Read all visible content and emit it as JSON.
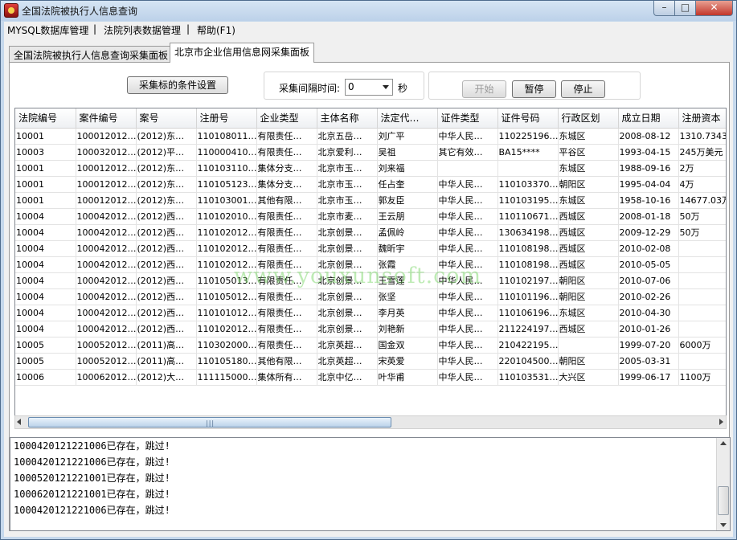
{
  "window": {
    "title": "全国法院被执行人信息查询"
  },
  "menu": {
    "items": [
      "MYSQL数据库管理",
      "|",
      "法院列表数据管理",
      "|",
      "帮助(F1)"
    ]
  },
  "tabs": [
    "全国法院被执行人信息查询采集面板",
    "北京市企业信用信息网采集面板"
  ],
  "toolbar": {
    "conditions_button": "采集标的条件设置",
    "interval_label": "采集间隔时间:",
    "interval_value": "0",
    "interval_unit": "秒",
    "start_button": "开始",
    "pause_button": "暂停",
    "stop_button": "停止"
  },
  "table": {
    "headers": [
      "法院编号",
      "案件编号",
      "案号",
      "注册号",
      "企业类型",
      "主体名称",
      "法定代…",
      "证件类型",
      "证件号码",
      "行政区划",
      "成立日期",
      "注册资本"
    ],
    "rows": [
      [
        "10001",
        "100012012…",
        "(2012)东…",
        "110108011…",
        "有限责任…",
        "北京五岳…",
        "刘广平",
        "中华人民…",
        "110225196…",
        "东城区",
        "2008-08-12",
        "1310.7343万"
      ],
      [
        "10003",
        "100032012…",
        "(2012)平…",
        "110000410…",
        "有限责任…",
        "北京爱利…",
        "吴祖",
        "其它有效…",
        "BA15****",
        "平谷区",
        "1993-04-15",
        "245万美元"
      ],
      [
        "10001",
        "100012012…",
        "(2012)东…",
        "110103110…",
        "集体分支…",
        "北京市玉…",
        "刘来福",
        "",
        "",
        "东城区",
        "1988-09-16",
        "2万"
      ],
      [
        "10001",
        "100012012…",
        "(2012)东…",
        "110105123…",
        "集体分支…",
        "北京市玉…",
        "任占奎",
        "中华人民…",
        "110103370…",
        "朝阳区",
        "1995-04-04",
        "4万"
      ],
      [
        "10001",
        "100012012…",
        "(2012)东…",
        "110103001…",
        "其他有限…",
        "北京市玉…",
        "郭友臣",
        "中华人民…",
        "110103195…",
        "东城区",
        "1958-10-16",
        "14677.03万"
      ],
      [
        "10004",
        "100042012…",
        "(2012)西…",
        "110102010…",
        "有限责任…",
        "北京市麦…",
        "王云朋",
        "中华人民…",
        "110110671…",
        "西城区",
        "2008-01-18",
        "50万"
      ],
      [
        "10004",
        "100042012…",
        "(2012)西…",
        "110102012…",
        "有限责任…",
        "北京创景…",
        "孟佩岭",
        "中华人民…",
        "130634198…",
        "西城区",
        "2009-12-29",
        "50万"
      ],
      [
        "10004",
        "100042012…",
        "(2012)西…",
        "110102012…",
        "有限责任…",
        "北京创景…",
        "魏昕宇",
        "中华人民…",
        "110108198…",
        "西城区",
        "2010-02-08",
        ""
      ],
      [
        "10004",
        "100042012…",
        "(2012)西…",
        "110102012…",
        "有限责任…",
        "北京创景…",
        "张霞",
        "中华人民…",
        "110108198…",
        "西城区",
        "2010-05-05",
        ""
      ],
      [
        "10004",
        "100042012…",
        "(2012)西…",
        "110105013…",
        "有限责任…",
        "北京创景…",
        "王雪莲",
        "中华人民…",
        "110102197…",
        "朝阳区",
        "2010-07-06",
        ""
      ],
      [
        "10004",
        "100042012…",
        "(2012)西…",
        "110105012…",
        "有限责任…",
        "北京创景…",
        "张坚",
        "中华人民…",
        "110101196…",
        "朝阳区",
        "2010-02-26",
        ""
      ],
      [
        "10004",
        "100042012…",
        "(2012)西…",
        "110101012…",
        "有限责任…",
        "北京创景…",
        "李月英",
        "中华人民…",
        "110106196…",
        "东城区",
        "2010-04-30",
        ""
      ],
      [
        "10004",
        "100042012…",
        "(2012)西…",
        "110102012…",
        "有限责任…",
        "北京创景…",
        "刘艳新",
        "中华人民…",
        "211224197…",
        "西城区",
        "2010-01-26",
        ""
      ],
      [
        "10005",
        "100052012…",
        "(2011)高…",
        "110302000…",
        "有限责任…",
        "北京英超…",
        "国金双",
        "中华人民…",
        "210422195…",
        "",
        "1999-07-20",
        "6000万"
      ],
      [
        "10005",
        "100052012…",
        "(2011)高…",
        "110105180…",
        "其他有限…",
        "北京英超…",
        "宋英爱",
        "中华人民…",
        "220104500…",
        "朝阳区",
        "2005-03-31",
        ""
      ],
      [
        "10006",
        "100062012…",
        "(2012)大…",
        "111115000…",
        "集体所有…",
        "北京中亿…",
        "叶华甫",
        "中华人民…",
        "110103531…",
        "大兴区",
        "1999-06-17",
        "1100万"
      ]
    ]
  },
  "log": {
    "lines": [
      "1000420121221006已存在，跳过!",
      "1000420121221006已存在，跳过!",
      "1000520121221001已存在，跳过!",
      "1000620121221001已存在，跳过!",
      "1000420121221006已存在，跳过!"
    ]
  },
  "watermark": "www.youxunsoft.com",
  "colors": {
    "titlebar": "#bcd1e9",
    "close_button": "#c2362a",
    "watermark": "#6ed25a"
  },
  "icons": [
    "app-icon",
    "minimize-icon",
    "maximize-icon",
    "close-icon",
    "combo-arrow-icon",
    "scroll-left-icon",
    "scroll-right-icon",
    "scroll-up-icon",
    "scroll-down-icon"
  ]
}
